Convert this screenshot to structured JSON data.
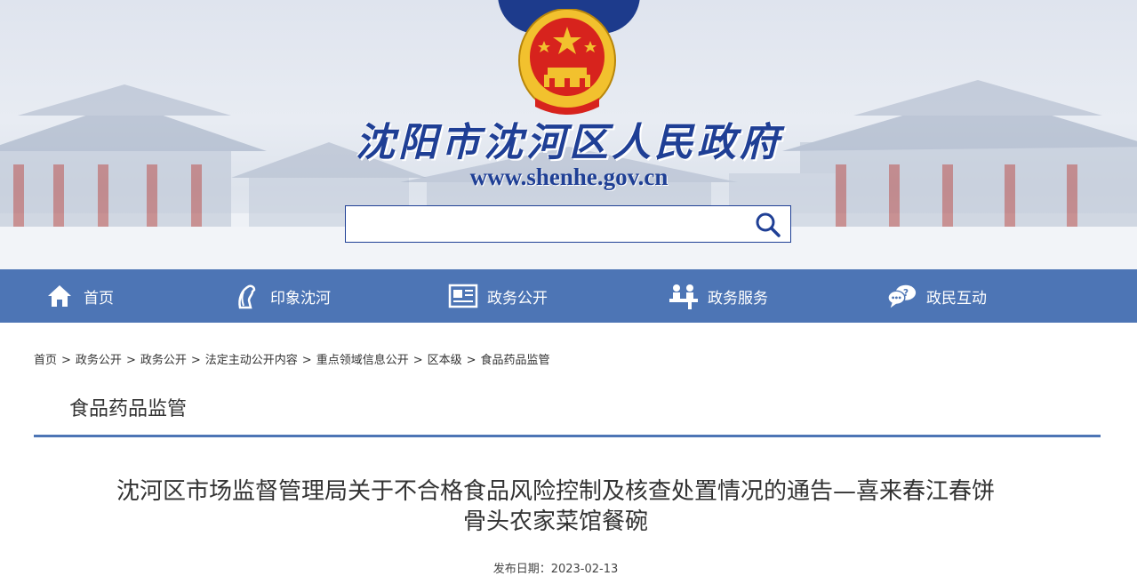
{
  "header": {
    "site_title": "沈阳市沈河区人民政府",
    "site_url": "www.shenhe.gov.cn",
    "search": {
      "value": "",
      "placeholder": ""
    },
    "emblem_icon": "national-emblem-icon",
    "search_icon": "search-icon"
  },
  "nav": {
    "items": [
      {
        "label": "首页",
        "icon": "home-icon"
      },
      {
        "label": "印象沈河",
        "icon": "horse-icon"
      },
      {
        "label": "政务公开",
        "icon": "newspaper-icon"
      },
      {
        "label": "政务服务",
        "icon": "service-desk-icon"
      },
      {
        "label": "政民互动",
        "icon": "chat-question-icon"
      }
    ]
  },
  "breadcrumb": [
    "首页",
    "政务公开",
    "政务公开",
    "法定主动公开内容",
    "重点领域信息公开",
    "区本级",
    "食品药品监管"
  ],
  "section": {
    "title": "食品药品监管"
  },
  "article": {
    "title_line1": "沈河区市场监督管理局关于不合格食品风险控制及核查处置情况的通告—喜来春江春饼",
    "title_line2": "骨头农家菜馆餐碗",
    "date_label": "发布日期：",
    "date": "2023-02-13"
  },
  "colors": {
    "brand_blue": "#1f3f95",
    "nav_blue": "#4d75b5",
    "emblem_red": "#d7231d",
    "emblem_gold": "#f2c12e"
  }
}
